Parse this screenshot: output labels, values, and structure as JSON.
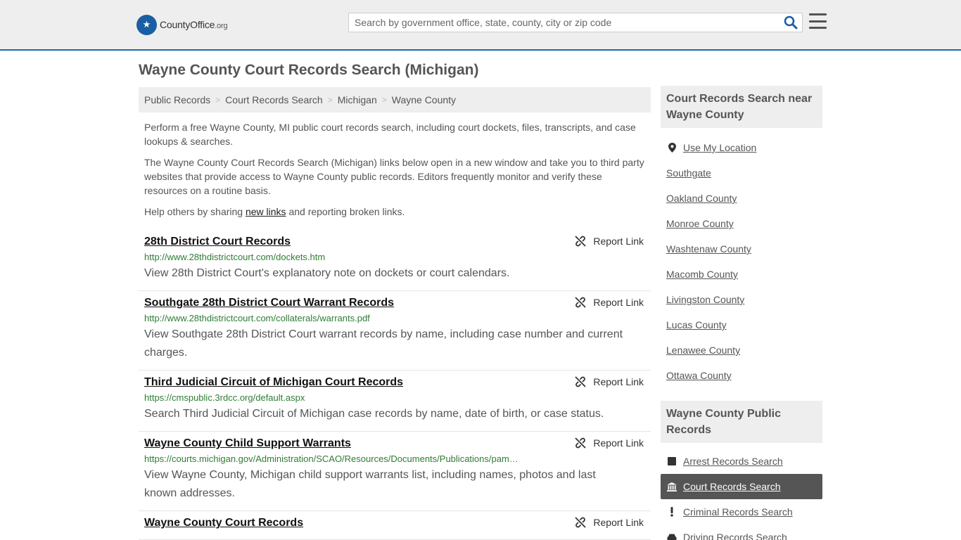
{
  "header": {
    "logo_text_main": "CountyOffice",
    "logo_text_tld": ".org",
    "search_placeholder": "Search by government office, state, county, city or zip code"
  },
  "page_title": "Wayne County Court Records Search (Michigan)",
  "breadcrumb": [
    "Public Records",
    "Court Records Search",
    "Michigan",
    "Wayne County"
  ],
  "intro": {
    "p1": "Perform a free Wayne County, MI public court records search, including court dockets, files, transcripts, and case lookups & searches.",
    "p2": "The Wayne County Court Records Search (Michigan) links below open in a new window and take you to third party websites that provide access to Wayne County public records. Editors frequently monitor and verify these resources on a routine basis.",
    "p3_before": "Help others by sharing ",
    "p3_link": "new links",
    "p3_after": " and reporting broken links."
  },
  "report_label": "Report Link",
  "records": [
    {
      "title": "28th District Court Records",
      "url": "http://www.28thdistrictcourt.com/dockets.htm",
      "desc": "View 28th District Court's explanatory note on dockets or court calendars."
    },
    {
      "title": "Southgate 28th District Court Warrant Records",
      "url": "http://www.28thdistrictcourt.com/collaterals/warrants.pdf",
      "desc": "View Southgate 28th District Court warrant records by name, including case number and current charges."
    },
    {
      "title": "Third Judicial Circuit of Michigan Court Records",
      "url": "https://cmspublic.3rdcc.org/default.aspx",
      "desc": "Search Third Judicial Circuit of Michigan case records by name, date of birth, or case status."
    },
    {
      "title": "Wayne County Child Support Warrants",
      "url": "https://courts.michigan.gov/Administration/SCAO/Resources/Documents/Publications/pam…",
      "desc": "View Wayne County, Michigan child support warrants list, including names, photos and last known addresses."
    },
    {
      "title": "Wayne County Court Records",
      "url": "",
      "desc": ""
    }
  ],
  "sidebar": {
    "nearby_title": "Court Records Search near Wayne County",
    "nearby": [
      "Use My Location",
      "Southgate",
      "Oakland County",
      "Monroe County",
      "Washtenaw County",
      "Macomb County",
      "Livingston County",
      "Lucas County",
      "Lenawee County",
      "Ottawa County"
    ],
    "public_title": "Wayne County Public Records",
    "public": [
      {
        "label": "Arrest Records Search",
        "icon": "square-icon",
        "active": false
      },
      {
        "label": "Court Records Search",
        "icon": "courthouse-icon",
        "active": true
      },
      {
        "label": "Criminal Records Search",
        "icon": "exclamation-icon",
        "active": false
      },
      {
        "label": "Driving Records Search",
        "icon": "car-icon",
        "active": false
      }
    ]
  },
  "colors": {
    "brand_blue": "#1a5fa3",
    "url_green": "#2e7d32",
    "active_bg": "#555555"
  }
}
